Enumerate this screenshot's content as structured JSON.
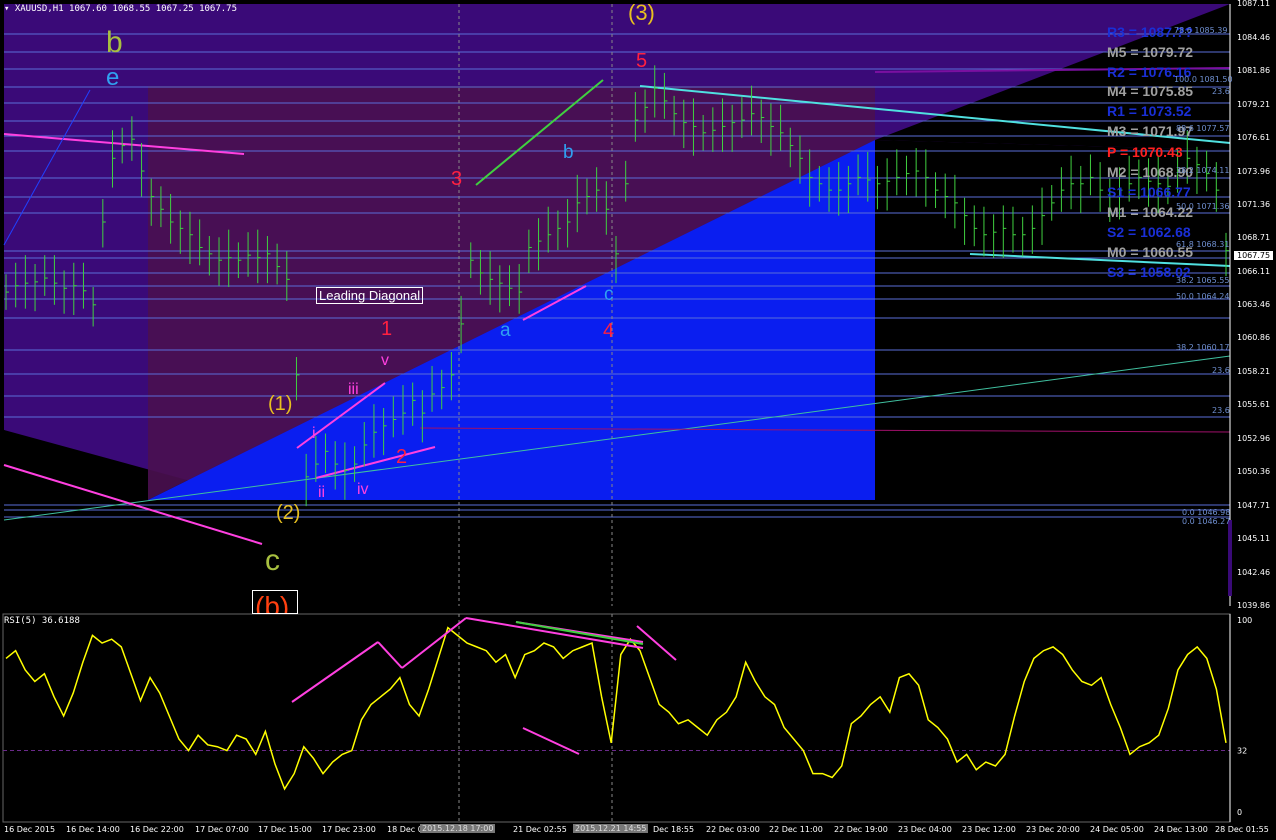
{
  "header": {
    "symbol": "XAUUSD,H1",
    "ohlc": "1067.60 1068.55 1067.25 1067.75"
  },
  "rsi_header": "RSI(5) 36.6188",
  "current_price": "1067.75",
  "leading_diagonal": "Leading Diagonal",
  "pivots": [
    {
      "label": "R3 = 1087.??",
      "color": "#1a2fd6"
    },
    {
      "label": "M5 = 1079.72",
      "color": "#a0a0a0"
    },
    {
      "label": "R2 = 1076.16",
      "color": "#1a2fd6"
    },
    {
      "label": "M4 = 1075.85",
      "color": "#a0a0a0"
    },
    {
      "label": "R1 = 1073.52",
      "color": "#1a2fd6"
    },
    {
      "label": "M3 = 1071.97",
      "color": "#a0a0a0"
    },
    {
      "label": "P  = 1070.43",
      "color": "#ff2020"
    },
    {
      "label": "M2 = 1068.90",
      "color": "#a0a0a0"
    },
    {
      "label": "S1 = 1066.77",
      "color": "#1a2fd6"
    },
    {
      "label": "M1 = 1064.22",
      "color": "#a0a0a0"
    },
    {
      "label": "S2 = 1062.68",
      "color": "#1a2fd6"
    },
    {
      "label": "M0 = 1060.55",
      "color": "#a0a0a0"
    },
    {
      "label": "S3 = 1058.02",
      "color": "#1a2fd6"
    }
  ],
  "fib_labels": [
    "78.6 1085.39",
    "100.0 1081.50",
    "23.6",
    "88.6 1077.57",
    "38.2 1074.11",
    "50.0 1071.36",
    "61.8 1068.31",
    "38.2 1065.55",
    "50.0 1064.24",
    "38.2 1060.17",
    "23.6",
    "23.6",
    "0.0 1046.98",
    "0.0 1046.27"
  ],
  "wave_labels": {
    "b": "b",
    "e": "e",
    "c_big": "c",
    "b_paren": "(b)",
    "w3_paren": "(3)",
    "w5": "5",
    "w3": "3",
    "w1": "1",
    "w2": "2",
    "w4": "4",
    "p1": "(1)",
    "p2": "(2)",
    "sb": "b",
    "sa": "a",
    "sc": "c",
    "i": "i",
    "ii": "ii",
    "iii": "iii",
    "iv": "iv",
    "v": "v"
  },
  "chart_data": {
    "type": "line",
    "title": "XAUUSD,H1",
    "ylim": [
      1039.86,
      1087.11
    ],
    "y_ticks": [
      "1087.11",
      "1084.46",
      "1081.86",
      "1079.21",
      "1076.61",
      "1073.96",
      "1071.36",
      "1068.71",
      "1066.11",
      "1063.46",
      "1060.86",
      "1058.21",
      "1055.61",
      "1052.96",
      "1050.36",
      "1047.71",
      "1045.11",
      "1042.46",
      "1039.86"
    ],
    "x_ticks": [
      "16 Dec 2015",
      "16 Dec 14:00",
      "16 Dec 22:00",
      "17 Dec 07:00",
      "17 Dec 15:00",
      "17 Dec 23:00",
      "18 Dec 08:00",
      "2015.12.18 17:00",
      "21 Dec 02:55",
      "2015.12.21 14:55",
      "Dec 18:55",
      "22 Dec 03:00",
      "22 Dec 11:00",
      "22 Dec 19:00",
      "23 Dec 04:00",
      "23 Dec 12:00",
      "23 Dec 20:00",
      "24 Dec 05:00",
      "24 Dec 13:00",
      "28 Dec 01:55"
    ],
    "series": [
      {
        "name": "XAUUSD,H1",
        "values": [
          1064.5,
          1065.0,
          1065.2,
          1065.3,
          1065.6,
          1065.2,
          1064.8,
          1065.0,
          1064.6,
          1063.5,
          1070.0,
          1075.0,
          1076.0,
          1076.5,
          1074.0,
          1072.0,
          1071.0,
          1070.0,
          1069.5,
          1069.0,
          1068.0,
          1067.5,
          1067.0,
          1067.2,
          1067.0,
          1067.4,
          1067.2,
          1067.5,
          1066.5,
          1065.5,
          1058.0,
          1050.0,
          1051.0,
          1052.0,
          1051.0,
          1050.5,
          1051.0,
          1052.5,
          1053.5,
          1054.0,
          1054.5,
          1055.0,
          1056.0,
          1055.0,
          1056.5,
          1057.0,
          1058.0,
          1062.0,
          1067.0,
          1066.0,
          1065.5,
          1065.2,
          1064.8,
          1064.5,
          1068.0,
          1068.5,
          1069.0,
          1069.5,
          1070.0,
          1071.5,
          1072.0,
          1072.5,
          1071.0,
          1067.5,
          1073.0,
          1078.0,
          1079.0,
          1080.5,
          1079.5,
          1078.5,
          1077.8,
          1077.5,
          1077.0,
          1077.2,
          1077.5,
          1077.8,
          1078.0,
          1078.5,
          1078.2,
          1077.5,
          1077.0,
          1076.0,
          1075.0,
          1073.5,
          1073.0,
          1072.5,
          1072.5,
          1073.0,
          1073.5,
          1073.3,
          1073.0,
          1073.2,
          1073.5,
          1073.8,
          1074.0,
          1073.5,
          1072.5,
          1072.0,
          1071.5,
          1070.5,
          1069.5,
          1069.0,
          1069.2,
          1069.5,
          1069.0,
          1069.0,
          1069.5,
          1070.5,
          1071.5,
          1072.5,
          1073.0,
          1073.0,
          1073.5,
          1072.5,
          1072.0,
          1072.5,
          1073.0,
          1073.5,
          1073.2,
          1073.0,
          1072.8,
          1074.0,
          1075.0,
          1074.5,
          1073.8,
          1072.5,
          1067.75
        ]
      },
      {
        "name": "RSI(5)",
        "values": [
          80,
          84,
          74,
          68,
          72,
          60,
          50,
          62,
          78,
          92,
          88,
          90,
          86,
          72,
          58,
          70,
          62,
          50,
          38,
          32,
          40,
          35,
          34,
          32,
          40,
          38,
          30,
          42,
          25,
          12,
          20,
          34,
          28,
          20,
          26,
          30,
          32,
          48,
          56,
          60,
          64,
          70,
          56,
          50,
          64,
          80,
          96,
          92,
          88,
          86,
          84,
          78,
          82,
          70,
          82,
          84,
          88,
          86,
          80,
          84,
          86,
          88,
          60,
          36,
          82,
          90,
          84,
          70,
          56,
          52,
          46,
          48,
          44,
          40,
          48,
          52,
          60,
          78,
          68,
          60,
          56,
          44,
          38,
          32,
          20,
          20,
          18,
          24,
          46,
          50,
          56,
          60,
          52,
          70,
          72,
          66,
          48,
          44,
          38,
          26,
          30,
          22,
          26,
          24,
          30,
          50,
          68,
          80,
          84,
          86,
          82,
          74,
          68,
          66,
          70,
          56,
          44,
          30,
          34,
          36,
          40,
          54,
          74,
          82,
          86,
          80,
          64,
          36
        ]
      }
    ],
    "rsi_ylim": [
      0,
      100
    ],
    "rsi_ticks": [
      "100",
      "32",
      "0"
    ]
  }
}
